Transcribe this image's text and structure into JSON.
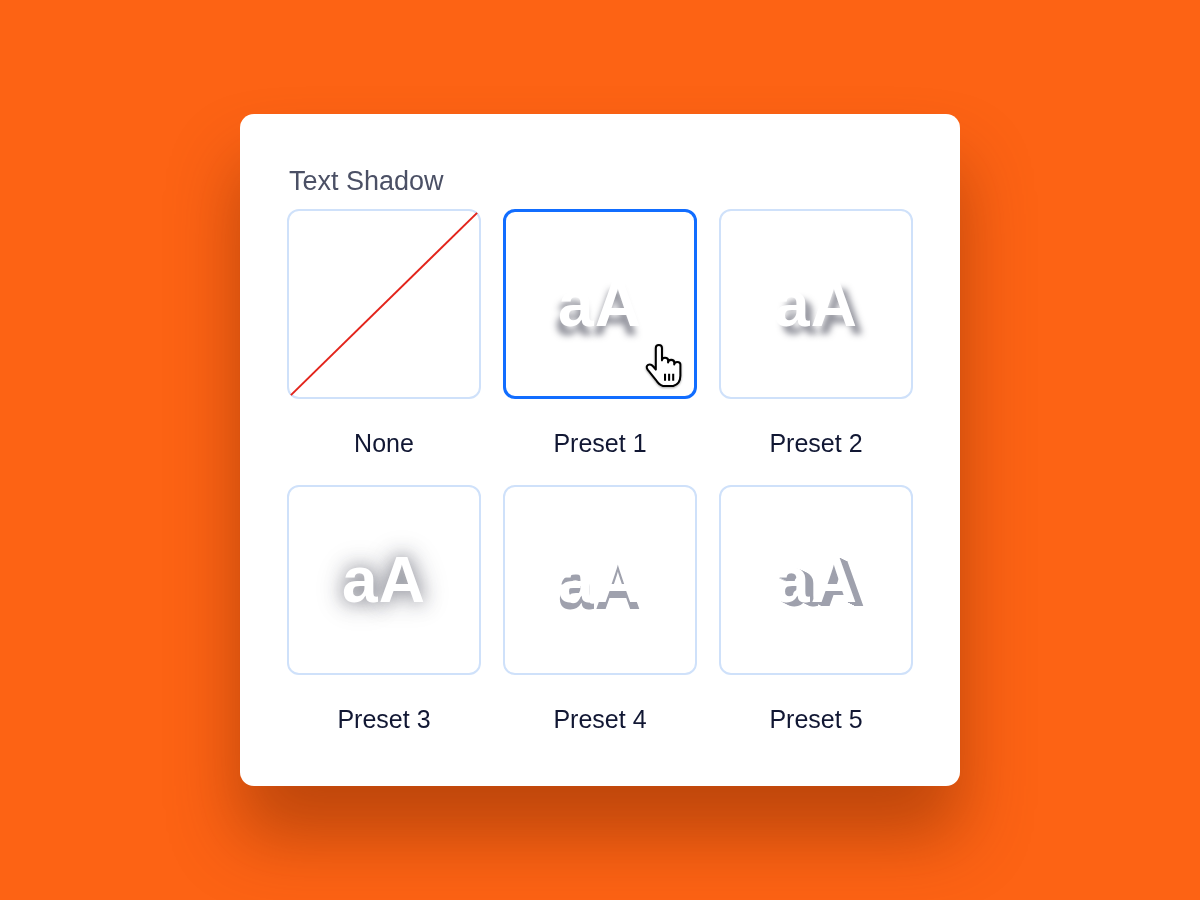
{
  "panel": {
    "title": "Text Shadow",
    "options": [
      {
        "label": "None",
        "kind": "none",
        "selected": false,
        "hovered": false
      },
      {
        "label": "Preset 1",
        "kind": "soft",
        "sample": "aA",
        "selected": true,
        "hovered": true
      },
      {
        "label": "Preset 2",
        "kind": "offset",
        "sample": "aA",
        "selected": false,
        "hovered": false
      },
      {
        "label": "Preset 3",
        "kind": "glow",
        "sample": "aA",
        "selected": false,
        "hovered": false
      },
      {
        "label": "Preset 4",
        "kind": "hard",
        "sample": "aA",
        "selected": false,
        "hovered": false
      },
      {
        "label": "Preset 5",
        "kind": "slant",
        "sample": "aA",
        "selected": false,
        "hovered": false
      }
    ]
  }
}
